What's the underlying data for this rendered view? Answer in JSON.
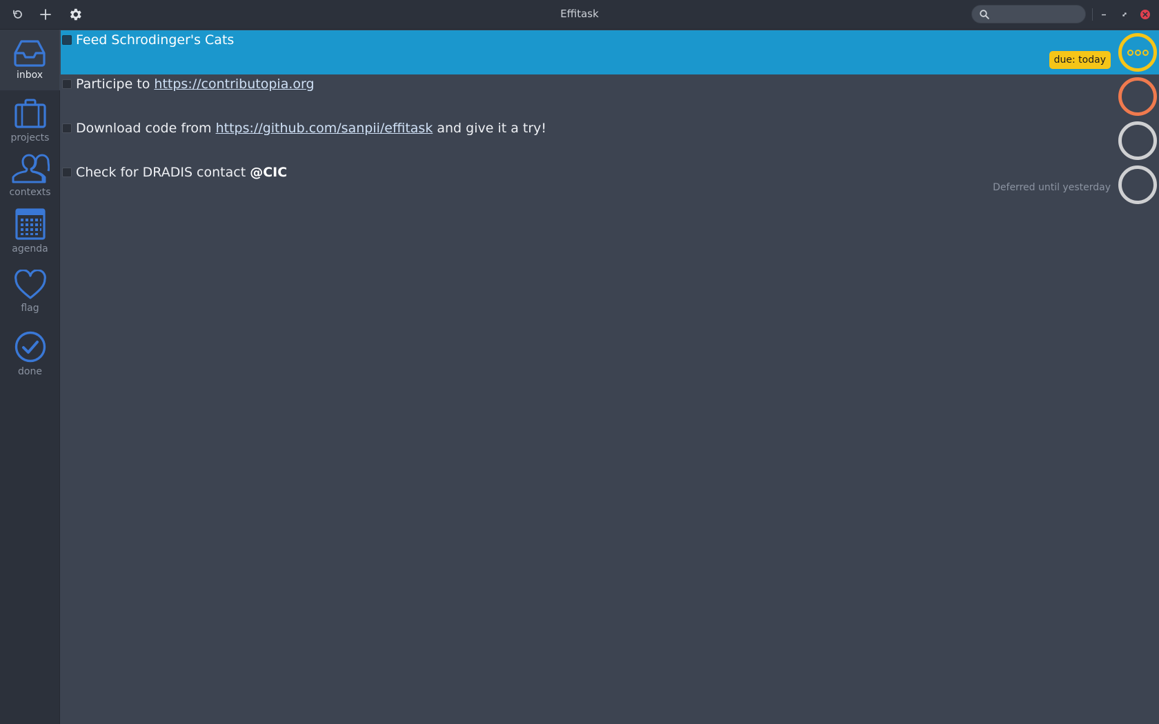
{
  "window": {
    "title": "Effitask"
  },
  "toolbar": {
    "buttons": [
      {
        "name": "refresh",
        "icon": "refresh-icon"
      },
      {
        "name": "add",
        "icon": "plus-icon"
      },
      {
        "name": "settings",
        "icon": "gear-icon"
      }
    ]
  },
  "search": {
    "value": "",
    "placeholder": ""
  },
  "window_controls": [
    "minimize-icon",
    "maximize-icon",
    "close-icon"
  ],
  "sidebar": {
    "items": [
      {
        "label": "inbox",
        "icon": "inbox-icon",
        "active": true
      },
      {
        "label": "projects",
        "icon": "briefcase-icon",
        "active": false
      },
      {
        "label": "contexts",
        "icon": "people-icon",
        "active": false
      },
      {
        "label": "agenda",
        "icon": "calendar-icon",
        "active": false
      },
      {
        "label": "flag",
        "icon": "heart-icon",
        "active": false
      },
      {
        "label": "done",
        "icon": "check-circle-icon",
        "active": false
      }
    ]
  },
  "tasks": [
    {
      "text": "Feed Schrodinger's Cats",
      "badge": "due: today",
      "status": "in-progress",
      "selected": true
    },
    {
      "prefix": "Participe to ",
      "link": "https://contributopia.org",
      "status": "priority",
      "selected": false
    },
    {
      "prefix": "Download code from ",
      "link": "https://github.com/sanpii/effitask",
      "suffix": " and give it a try!",
      "status": "todo",
      "selected": false
    },
    {
      "prefix": "Check for DRADIS contact ",
      "context": "@CIC",
      "note": "Deferred until yesterday",
      "status": "todo",
      "selected": false
    }
  ],
  "colors": {
    "accent": "#1b97cd",
    "icon_blue": "#3a78d6",
    "due_badge": "#f5c518",
    "priority_ring": "#f07a4e",
    "todo_ring": "#cfd0d2",
    "background": "#3d4451",
    "sidebar": "#2c313b"
  }
}
